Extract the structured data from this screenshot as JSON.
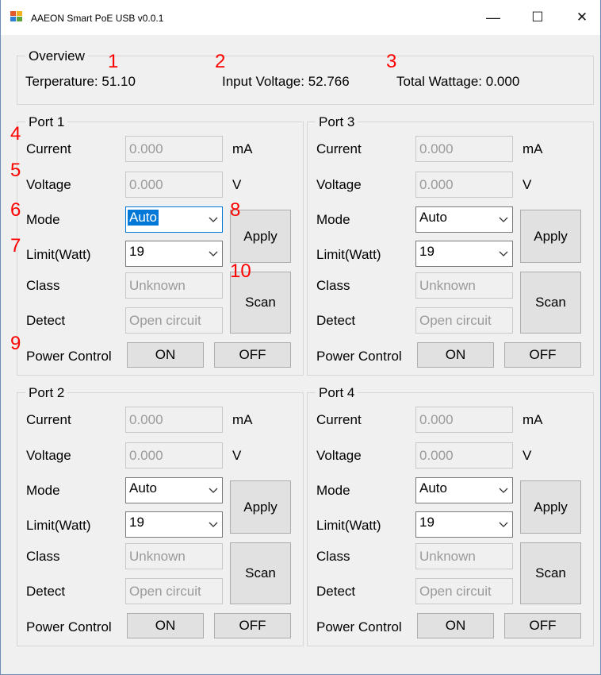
{
  "window": {
    "title": "AAEON Smart PoE USB v0.0.1"
  },
  "titlebar": {
    "minimize": "—",
    "maximize": "☐",
    "close": "✕"
  },
  "overview": {
    "legend": "Overview",
    "temperature": "Terperature: 51.10",
    "input_voltage": "Input Voltage: 52.766",
    "total_wattage": "Total Wattage: 0.000"
  },
  "labels": {
    "current": "Current",
    "voltage": "Voltage",
    "mode": "Mode",
    "limit": "Limit(Watt)",
    "class": "Class",
    "detect": "Detect",
    "power_control": "Power Control",
    "unit_ma": "mA",
    "unit_v": "V",
    "apply": "Apply",
    "scan": "Scan",
    "on": "ON",
    "off": "OFF"
  },
  "ports": [
    {
      "legend": "Port 1",
      "current": "0.000",
      "voltage": "0.000",
      "mode": "Auto",
      "limit": "19",
      "class": "Unknown",
      "detect": "Open circuit"
    },
    {
      "legend": "Port 3",
      "current": "0.000",
      "voltage": "0.000",
      "mode": "Auto",
      "limit": "19",
      "class": "Unknown",
      "detect": "Open circuit"
    },
    {
      "legend": "Port 2",
      "current": "0.000",
      "voltage": "0.000",
      "mode": "Auto",
      "limit": "19",
      "class": "Unknown",
      "detect": "Open circuit"
    },
    {
      "legend": "Port 4",
      "current": "0.000",
      "voltage": "0.000",
      "mode": "Auto",
      "limit": "19",
      "class": "Unknown",
      "detect": "Open circuit"
    }
  ],
  "annotations": [
    "1",
    "2",
    "3",
    "4",
    "5",
    "6",
    "7",
    "8",
    "9",
    "10"
  ],
  "colors": {
    "annotation": "#ff0000",
    "focus": "#0078d7",
    "window_bg": "#f0f0f0"
  }
}
